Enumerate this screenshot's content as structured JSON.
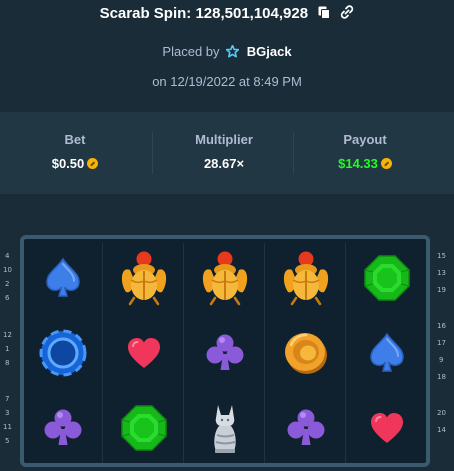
{
  "header": {
    "title": "Scarab Spin: 128,501,104,928",
    "placed_by_label": "Placed by",
    "username": "BGjack",
    "date": "on 12/19/2022 at 8:49 PM"
  },
  "stats": {
    "bet": {
      "label": "Bet",
      "value": "$0.50"
    },
    "multiplier": {
      "label": "Multiplier",
      "value": "28.67×"
    },
    "payout": {
      "label": "Payout",
      "value": "$14.33"
    }
  },
  "colors": {
    "background": "#1a2c38",
    "panel": "#213743",
    "payout_green": "#1fff20",
    "coin": "#f5b40b"
  },
  "reels": [
    [
      "spade-icon",
      "chip-icon",
      "club-icon"
    ],
    [
      "scarab-icon",
      "heart-icon",
      "emerald-icon"
    ],
    [
      "scarab-icon",
      "club-icon",
      "cat-statue-icon"
    ],
    [
      "scarab-icon",
      "gold-coin-icon",
      "club-icon"
    ],
    [
      "emerald-icon",
      "spade-icon",
      "heart-icon"
    ]
  ],
  "left_numbers": {
    "top": [
      "4",
      "10",
      "2",
      "6"
    ],
    "middle": [
      "12",
      "1",
      "8"
    ],
    "bottom": [
      "7",
      "3",
      "11",
      "5"
    ]
  },
  "right_numbers": {
    "top": [
      "15",
      "13",
      "19"
    ],
    "middle": [
      "16",
      "17",
      "9",
      "18"
    ],
    "bottom": [
      "20",
      "14"
    ]
  }
}
